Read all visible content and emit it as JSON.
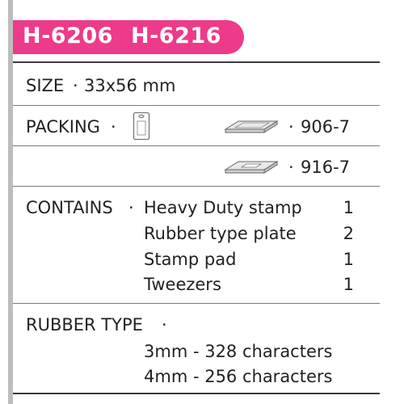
{
  "header": {
    "models": [
      "H-6206",
      "H-6216"
    ],
    "accent_color": "#ee3a8a"
  },
  "size": {
    "label": "SIZE",
    "bullet": "·",
    "value": "33x56  mm"
  },
  "packing": {
    "label": "PACKING",
    "bullet": "·",
    "hanger_icon": "hanger-pack-icon",
    "box_icon": "tray-box-icon",
    "options": [
      {
        "bullet": "·",
        "code": "906-7"
      },
      {
        "bullet": "·",
        "code": "916-7"
      }
    ]
  },
  "contains": {
    "label": "CONTAINS",
    "bullet": "·",
    "items": [
      {
        "name": "Heavy  Duty  stamp",
        "qty": "1"
      },
      {
        "name": "Rubber  type  plate",
        "qty": "2"
      },
      {
        "name": "Stamp  pad",
        "qty": "1"
      },
      {
        "name": "Tweezers",
        "qty": "1"
      }
    ]
  },
  "rubber_type": {
    "label": "RUBBER  TYPE",
    "bullet": "·",
    "options": [
      "3mm  -  328  characters",
      "4mm  -  256  characters"
    ]
  }
}
